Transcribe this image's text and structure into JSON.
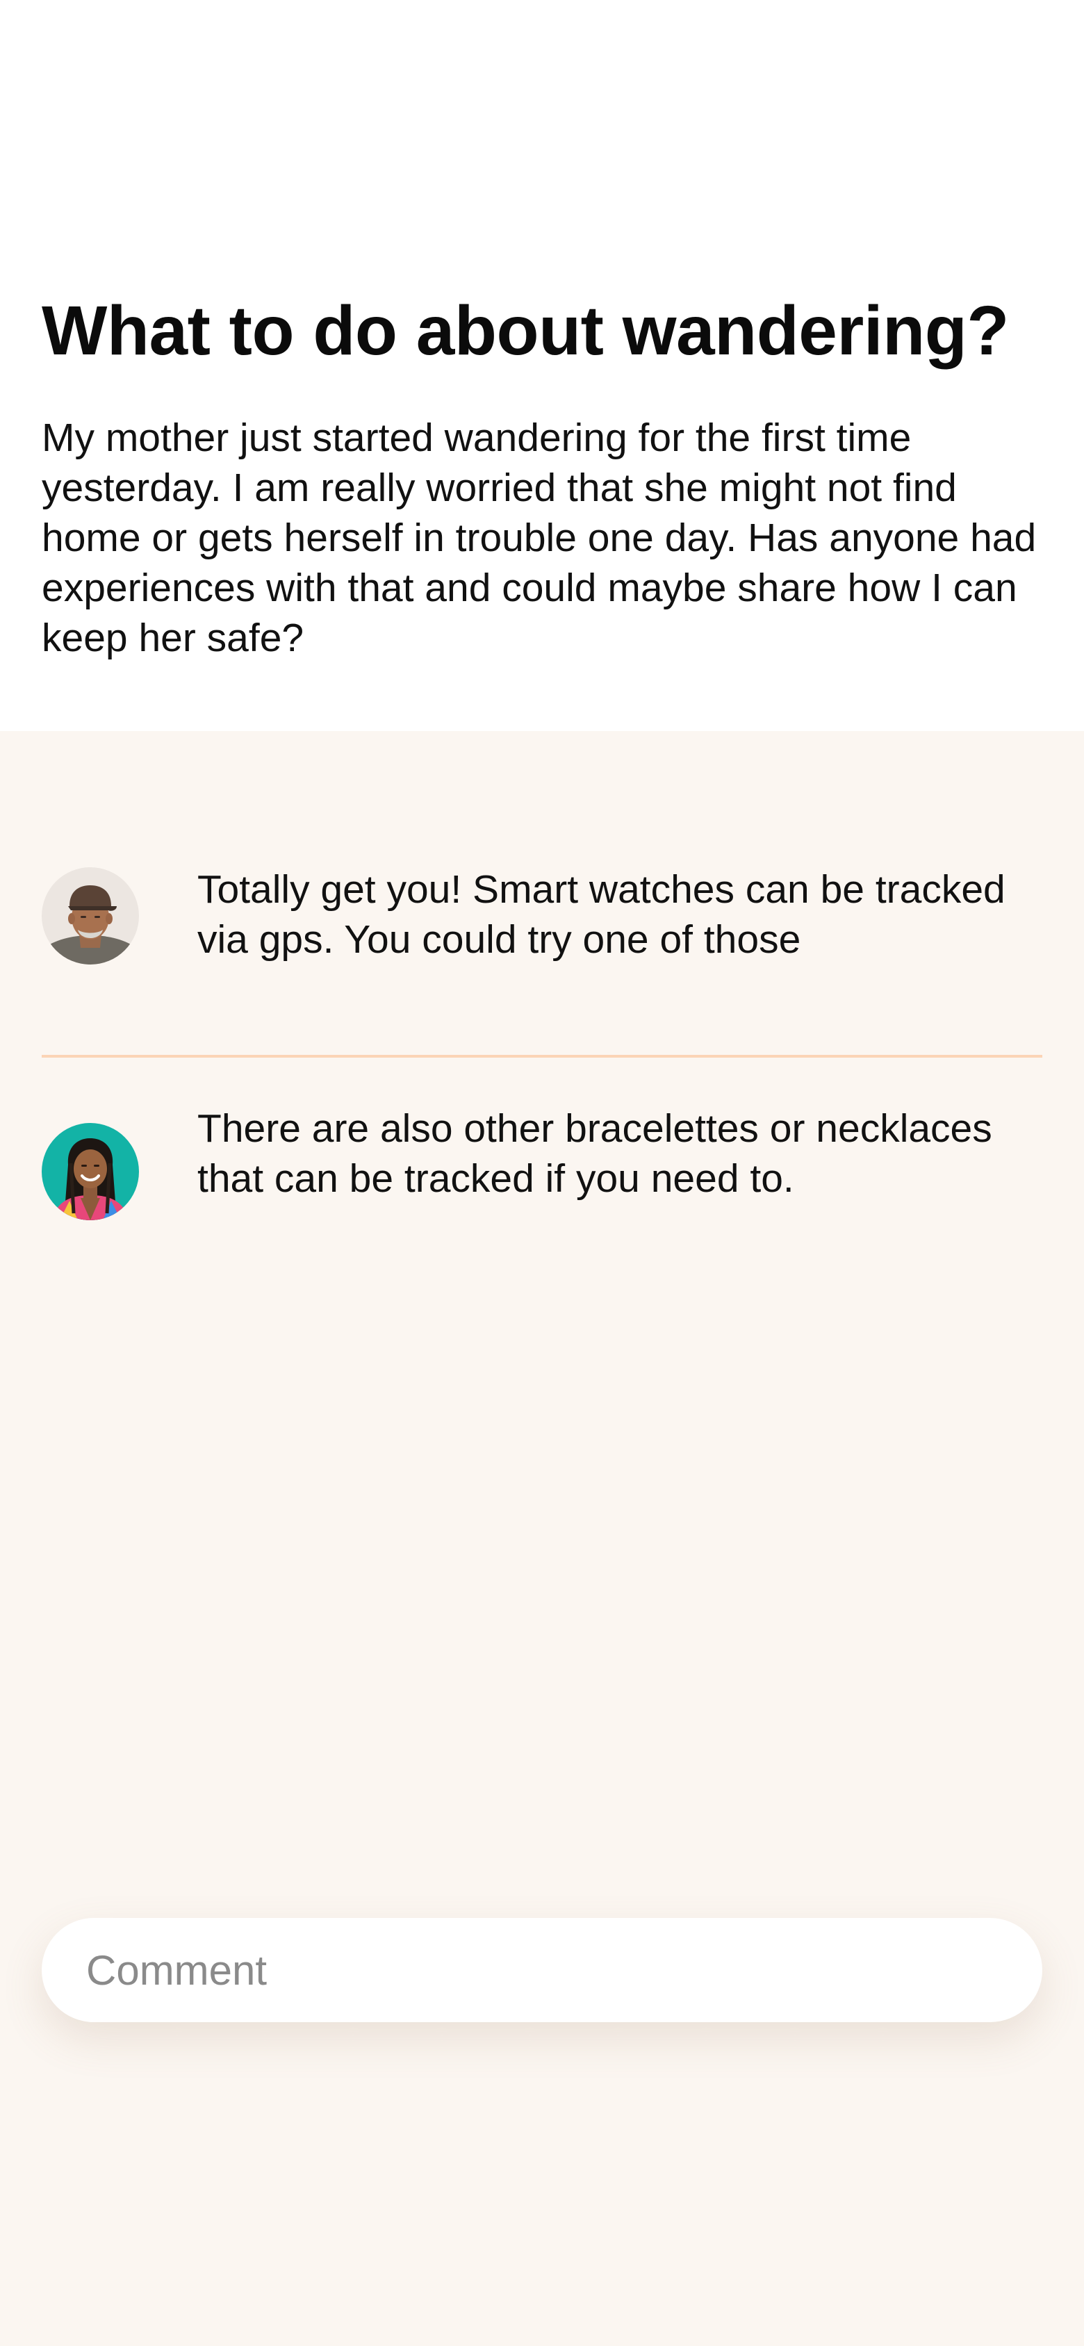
{
  "post": {
    "title": "What to do about wandering?",
    "body": "My mother just started wandering for the first time yesterday. I am really worried that she might not find home or gets herself in trouble one day. Has anyone had experiences with that and could maybe share how I can keep her safe?"
  },
  "comments": [
    {
      "avatar": "avatar-older-man-cap-icon",
      "text": "Totally get you! Smart watches can be tracked via gps. You could try one of those"
    },
    {
      "avatar": "avatar-woman-braids-icon",
      "text": "There are also other bracelettes or necklaces that can be tracked if you need to."
    }
  ],
  "comment_input": {
    "placeholder": "Comment",
    "value": ""
  },
  "colors": {
    "page_background": "#fbf6f1",
    "top_background": "#ffffff",
    "divider": "#fbd4b6",
    "text": "#111111",
    "placeholder": "#8a8a8a"
  }
}
